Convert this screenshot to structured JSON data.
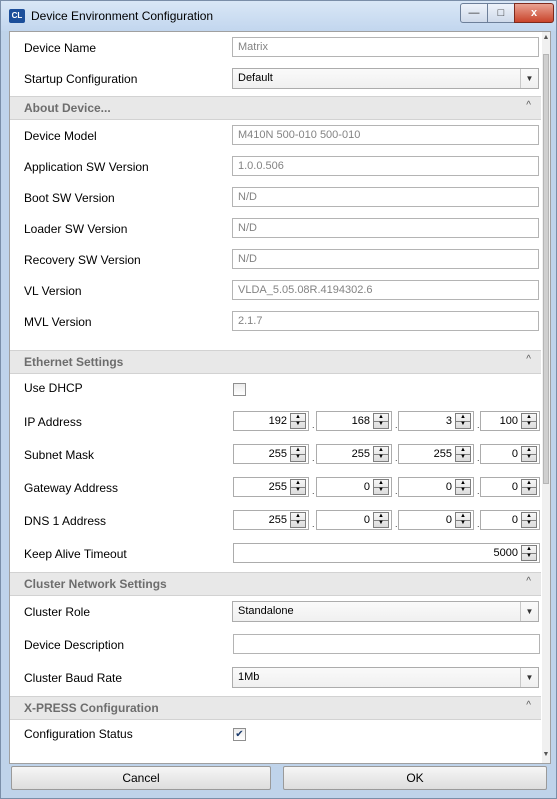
{
  "window": {
    "title": "Device Environment Configuration",
    "app_icon": "CL"
  },
  "titlebar_buttons": {
    "minimize": "—",
    "maximize": "□",
    "close": "x"
  },
  "general": {
    "device_name_label": "Device Name",
    "device_name_value": "Matrix",
    "startup_label": "Startup Configuration",
    "startup_value": "Default"
  },
  "about": {
    "title": "About Device...",
    "model_label": "Device Model",
    "model_value": "M410N 500-010 500-010",
    "app_sw_label": "Application SW Version",
    "app_sw_value": "1.0.0.506",
    "boot_sw_label": "Boot SW Version",
    "boot_sw_value": "N/D",
    "loader_sw_label": "Loader SW Version",
    "loader_sw_value": "N/D",
    "recovery_sw_label": "Recovery SW Version",
    "recovery_sw_value": "N/D",
    "vl_label": "VL Version",
    "vl_value": "VLDA_5.05.08R.4194302.6",
    "mvl_label": "MVL Version",
    "mvl_value": "2.1.7"
  },
  "ethernet": {
    "title": "Ethernet Settings",
    "dhcp_label": "Use DHCP",
    "dhcp_checked": false,
    "ip_label": "IP Address",
    "ip": [
      "192",
      "168",
      "3",
      "100"
    ],
    "subnet_label": "Subnet Mask",
    "subnet": [
      "255",
      "255",
      "255",
      "0"
    ],
    "gateway_label": "Gateway Address",
    "gateway": [
      "255",
      "0",
      "0",
      "0"
    ],
    "dns_label": "DNS 1 Address",
    "dns": [
      "255",
      "0",
      "0",
      "0"
    ],
    "keepalive_label": "Keep Alive Timeout",
    "keepalive_value": "5000"
  },
  "cluster": {
    "title": "Cluster Network Settings",
    "role_label": "Cluster Role",
    "role_value": "Standalone",
    "desc_label": "Device Description",
    "desc_value": "",
    "baud_label": "Cluster Baud Rate",
    "baud_value": "1Mb"
  },
  "xpress": {
    "title": "X-PRESS Configuration",
    "status_label": "Configuration Status",
    "status_checked": true
  },
  "icons": {
    "dropdown": "chevron-down-icon",
    "collapse": "chevron-up-icon",
    "check": "check-icon"
  },
  "footer": {
    "cancel": "Cancel",
    "ok": "OK"
  }
}
